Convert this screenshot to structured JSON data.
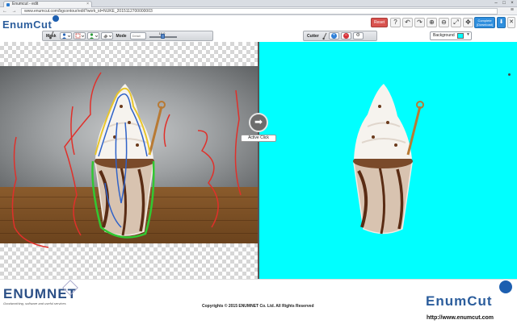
{
  "browser": {
    "tab_title": "Enumcut - edit",
    "tab_close": "×",
    "url": "www.enumcut.com/bgcontour/edit?work_id=NUKE_2015112700000003",
    "nav_glyphs": "← → ↻",
    "menu_glyph": "≡",
    "window_controls": [
      "–",
      "□",
      "×"
    ]
  },
  "header": {
    "logo": "EnumCut",
    "reset_label": "Reset",
    "tool_icons": [
      "?",
      "↶",
      "↷",
      "⊕",
      "⊖",
      "⤢",
      "✥"
    ],
    "complete_label": "Complete",
    "complete_sub": "(Download)",
    "download_glyph": "⬇",
    "close_glyph": "✕"
  },
  "mask_toolbar": {
    "label": "Mask",
    "mode_label": "Mode",
    "mode_value": "Detail",
    "brush_value": "10.0",
    "brush_level": 0.55
  },
  "cutter_toolbar": {
    "label": "Cutter",
    "add_glyph": "+",
    "remove_glyph": "−",
    "settings_glyph": "⚙",
    "background_label": "Background",
    "background_color": "#00ffff"
  },
  "canvas": {
    "active_click_label": "Active Click",
    "arrow_glyph": "➡"
  },
  "footer": {
    "left_logo": "ENUMNET",
    "tagline": "Goodworthing, software and useful services",
    "copyright": "Copyrights © 2015 ENUMNET Co. Ltd. All Rights Reserved",
    "right_logo": "EnumCut",
    "website": "http://www.enumcut.com"
  },
  "colors": {
    "accent_blue": "#2f8fde",
    "reset_red": "#d9534f",
    "cutout_background": "#00ffff",
    "stroke_red": "#e0302a",
    "stroke_blue": "#2f62c8",
    "stroke_green": "#32c832",
    "stroke_yellow": "#e8c62c"
  }
}
